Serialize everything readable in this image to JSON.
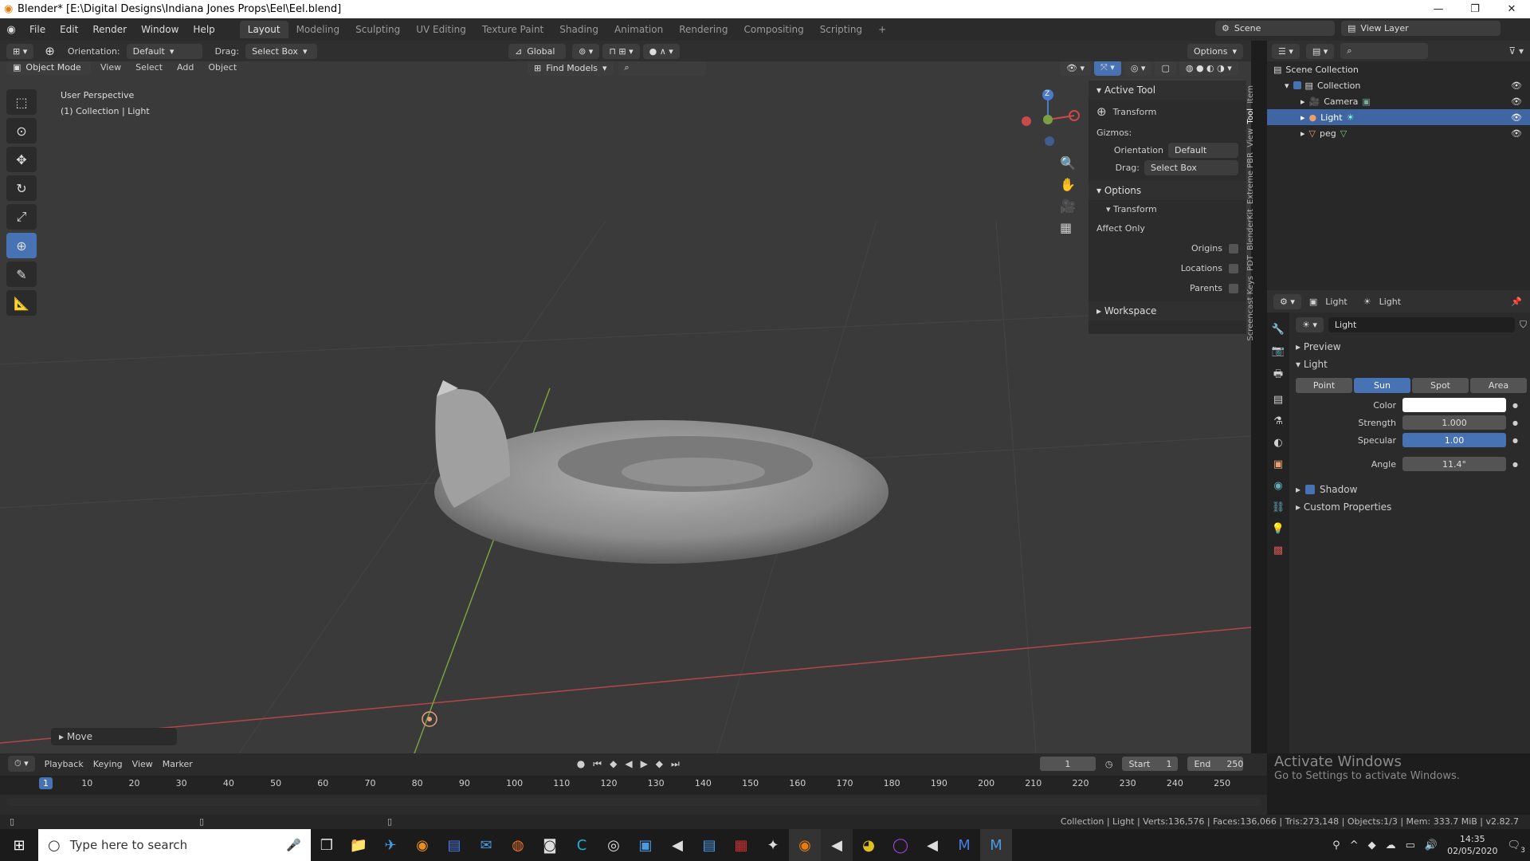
{
  "window": {
    "title": "Blender* [E:\\Digital Designs\\Indiana Jones Props\\Eel\\Eel.blend]",
    "controls": [
      "—",
      "❐",
      "✕"
    ]
  },
  "menu": [
    "File",
    "Edit",
    "Render",
    "Window",
    "Help"
  ],
  "workspaces": [
    "Layout",
    "Modeling",
    "Sculpting",
    "UV Editing",
    "Texture Paint",
    "Shading",
    "Animation",
    "Rendering",
    "Compositing",
    "Scripting"
  ],
  "workspace_add": "+",
  "scene": {
    "label": "Scene",
    "view_layer": "View Layer"
  },
  "toolheader": {
    "orientation_label": "Orientation:",
    "orientation_value": "Default",
    "drag_label": "Drag:",
    "drag_value": "Select Box",
    "transform_orientation": "Global",
    "options": "Options"
  },
  "viewheader": {
    "mode": "Object Mode",
    "items": [
      "View",
      "Select",
      "Add",
      "Object"
    ],
    "find_models": "Find Models"
  },
  "viewport": {
    "line1": "User Perspective",
    "line2": "(1) Collection | Light",
    "operator_panel": "Move",
    "gizmo_z": "Z"
  },
  "npanel": {
    "active_tool_header": "Active Tool",
    "tool_name": "Transform",
    "gizmos_label": "Gizmos:",
    "orientation_label": "Orientation",
    "orientation_value": "Default",
    "drag_label": "Drag:",
    "drag_value": "Select Box",
    "options_header": "Options",
    "transform_sub": "Transform",
    "affect_only": "Affect Only",
    "origins": "Origins",
    "locations": "Locations",
    "parents": "Parents",
    "workspace_header": "Workspace",
    "tabs": [
      "Item",
      "Tool",
      "View",
      "Extreme PBR",
      "BlenderKit",
      "PDT",
      "Screencast Keys"
    ]
  },
  "outliner": {
    "root": "Scene Collection",
    "collection": "Collection",
    "items": [
      "Camera",
      "Light",
      "peg"
    ]
  },
  "properties": {
    "breadcrumb1": "Light",
    "breadcrumb2": "Light",
    "datablock": "Light",
    "preview": "Preview",
    "light_header": "Light",
    "types": [
      "Point",
      "Sun",
      "Spot",
      "Area"
    ],
    "active_type": "Sun",
    "color_label": "Color",
    "strength_label": "Strength",
    "strength_value": "1.000",
    "specular_label": "Specular",
    "specular_value": "1.00",
    "angle_label": "Angle",
    "angle_value": "11.4°",
    "shadow": "Shadow",
    "custom_properties": "Custom Properties",
    "light_color": "#ffffff"
  },
  "timeline": {
    "menus": [
      "Playback",
      "Keying",
      "View",
      "Marker"
    ],
    "current_frame": "1",
    "start_label": "Start",
    "start": "1",
    "end_label": "End",
    "end": "250",
    "ticks": [
      "1",
      "10",
      "20",
      "30",
      "40",
      "50",
      "60",
      "70",
      "80",
      "90",
      "100",
      "110",
      "120",
      "130",
      "140",
      "150",
      "160",
      "170",
      "180",
      "190",
      "200",
      "210",
      "220",
      "230",
      "240",
      "250"
    ],
    "activate_title": "Activate Windows",
    "activate_sub": "Go to Settings to activate Windows."
  },
  "status": {
    "stats": "Collection | Light | Verts:136,576 | Faces:136,066 | Tris:273,148 | Objects:1/3 | Mem: 333.7 MiB | v2.82.7"
  },
  "taskbar": {
    "search_placeholder": "Type here to search",
    "time": "14:35",
    "date": "02/05/2020",
    "notif_count": "3"
  },
  "colors": {
    "accent": "#4772b3",
    "viewport_bg": "#3a3a3a",
    "x_axis": "#b54646",
    "y_axis": "#7aa040"
  }
}
